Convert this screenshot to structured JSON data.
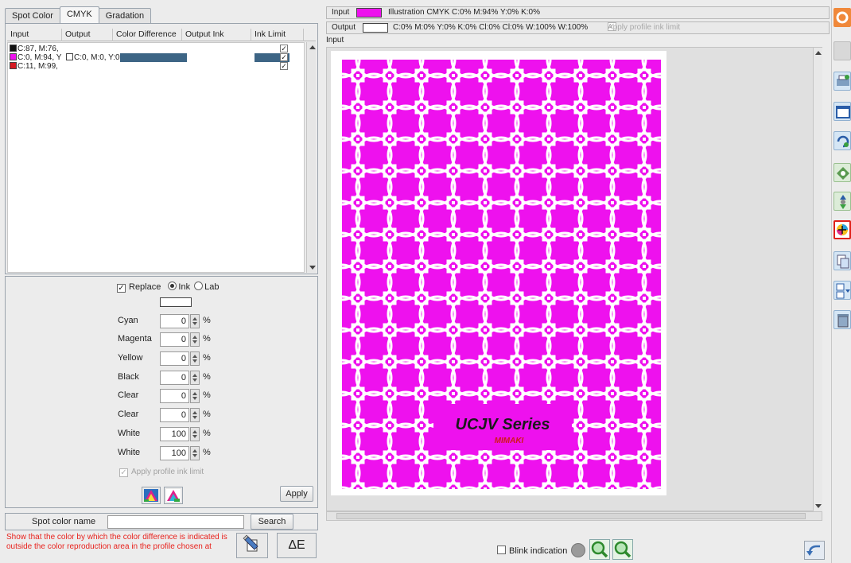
{
  "tabs": [
    {
      "label": "Spot Color"
    },
    {
      "label": "CMYK"
    },
    {
      "label": "Gradation"
    }
  ],
  "table": {
    "headers": [
      "Input",
      "Output",
      "Color Difference",
      "Output Ink",
      "Ink Limit"
    ],
    "rows": [
      {
        "input": "C:87, M:76,",
        "input_color": "#111111",
        "output": "",
        "ink_limit": "✓"
      },
      {
        "input": "C:0, M:94, Y",
        "input_color": "#ee11ee",
        "output": "C:0, M:0, Y:0",
        "ink_limit": "✓"
      },
      {
        "input": "C:11, M:99,",
        "input_color": "#d41a22",
        "output": "",
        "ink_limit": "✓"
      }
    ]
  },
  "replace": {
    "label": "Replace",
    "checked": "✓",
    "opt_ink": "Ink",
    "opt_lab": "Lab"
  },
  "inks": [
    {
      "label": "Cyan",
      "value": "0"
    },
    {
      "label": "Magenta",
      "value": "0"
    },
    {
      "label": "Yellow",
      "value": "0"
    },
    {
      "label": "Black",
      "value": "0"
    },
    {
      "label": "Clear",
      "value": "0"
    },
    {
      "label": "Clear",
      "value": "0"
    },
    {
      "label": "White",
      "value": "100"
    },
    {
      "label": "White",
      "value": "100"
    }
  ],
  "pct_symbol": "%",
  "apply_profile_limit": "Apply profile ink limit",
  "apply_button": "Apply",
  "spot": {
    "label": "Spot color name",
    "value": "",
    "search_button": "Search"
  },
  "warning_text": "Show that the color by which the color difference is indicated is outside the color reproduction area in the profile chosen at",
  "delta_e_button": "ΔE",
  "info_input": {
    "label": "Input",
    "swatch_color": "#ee11ee",
    "text": "Illustration CMYK C:0% M:94% Y:0% K:0%"
  },
  "info_output": {
    "label": "Output",
    "swatch_color": "#ffffff",
    "text": "C:0% M:0% Y:0% K:0% Cl:0% Cl:0% W:100% W:100%",
    "apply_label": "Apply profile ink limit"
  },
  "preview_label": "Input",
  "logo": {
    "title": "UCJV Series",
    "brand": "MIMAKI"
  },
  "bottom": {
    "blink_label": "Blink indication"
  },
  "colors": {
    "magenta": "#ee11ee",
    "selection": "#3d6585",
    "warning": "#e8231e"
  }
}
